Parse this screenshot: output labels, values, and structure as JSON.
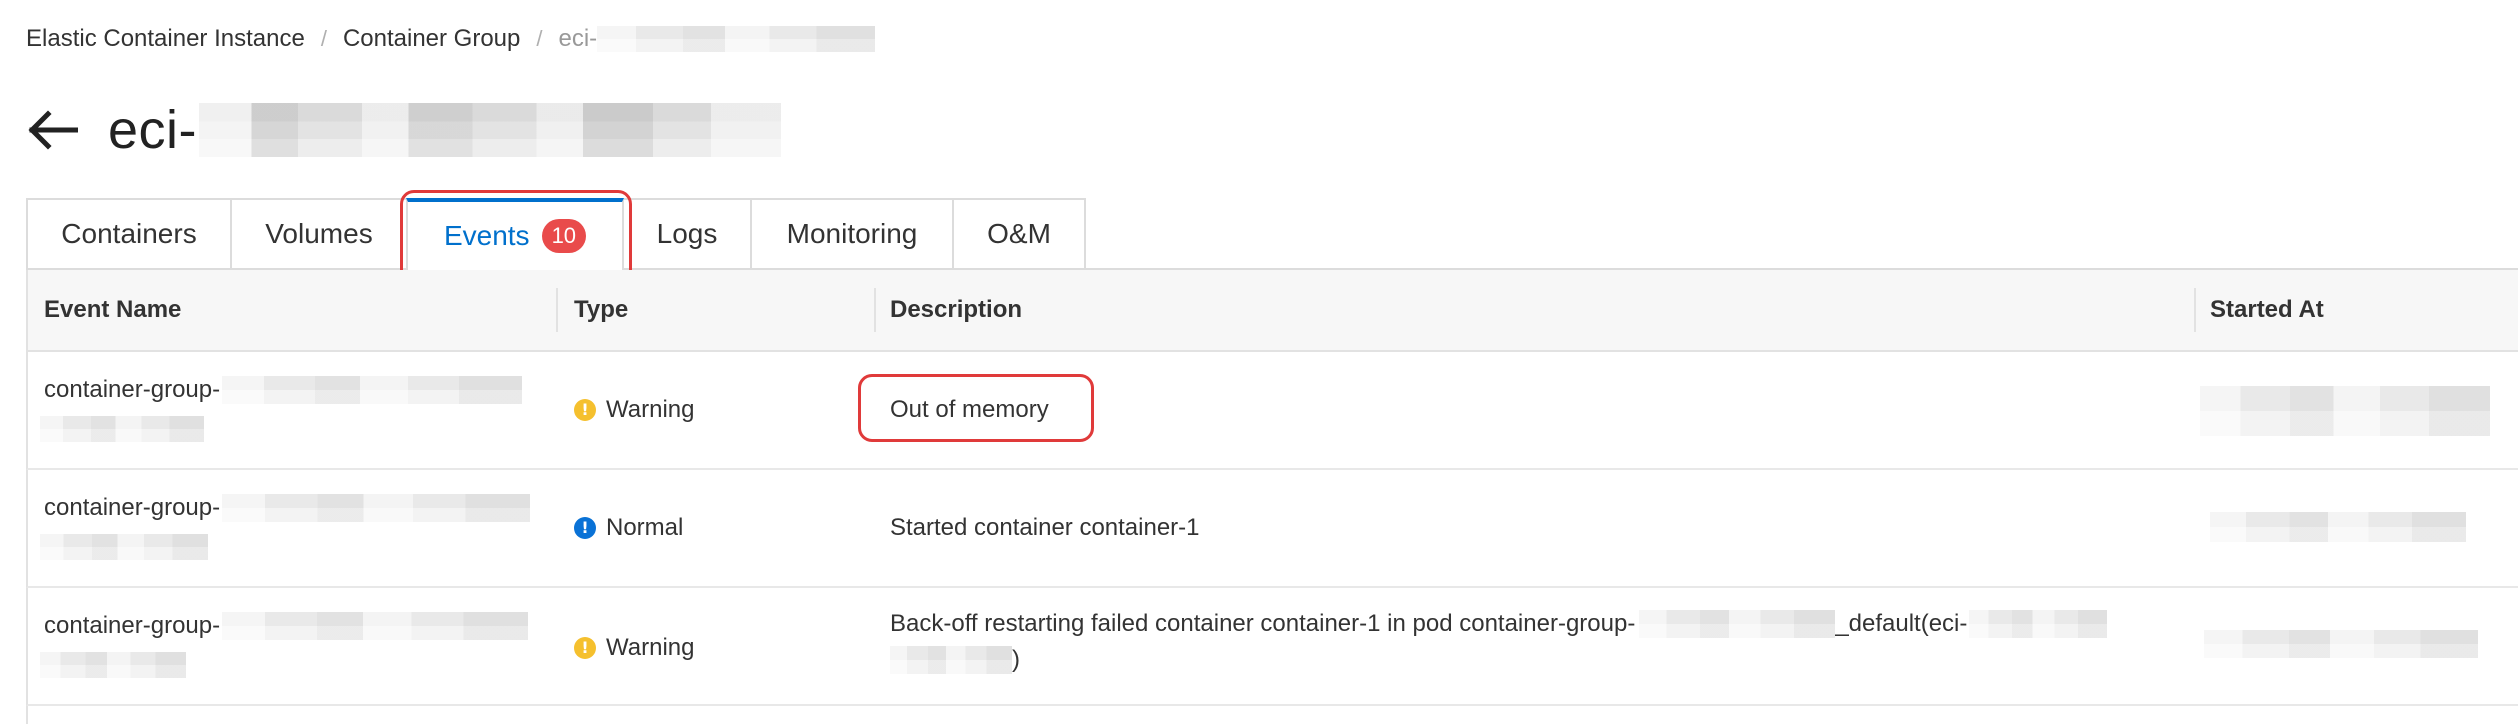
{
  "breadcrumb": {
    "items": [
      "Elastic Container Instance",
      "Container Group",
      "eci-"
    ],
    "separator": "/"
  },
  "title": {
    "text": "eci-"
  },
  "tabs": [
    {
      "label": "Containers"
    },
    {
      "label": "Volumes"
    },
    {
      "label": "Events",
      "badge": "10",
      "active": true
    },
    {
      "label": "Logs"
    },
    {
      "label": "Monitoring"
    },
    {
      "label": "O&M"
    }
  ],
  "table": {
    "columns": [
      "Event Name",
      "Type",
      "Description",
      "Started At"
    ],
    "rows": [
      {
        "name": "container-group-",
        "type": "Warning",
        "type_icon": "warning-icon",
        "description_line1": "Out of memory",
        "description_line2": ""
      },
      {
        "name": "container-group-",
        "type": "Normal",
        "type_icon": "info-icon",
        "description_line1": "Started container container-1",
        "description_line2": ""
      },
      {
        "name": "container-group-",
        "type": "Warning",
        "type_icon": "warning-icon",
        "description_line1": "Back-off restarting failed container container-1 in pod container-group-",
        "description_mid": "_default(eci-",
        "description_line2": ")"
      }
    ]
  },
  "colors": {
    "accent": "#0070cc",
    "badge": "#e94b4b",
    "highlight": "#e03a3a",
    "warning": "#f5c02e",
    "normal": "#0a72d6"
  }
}
